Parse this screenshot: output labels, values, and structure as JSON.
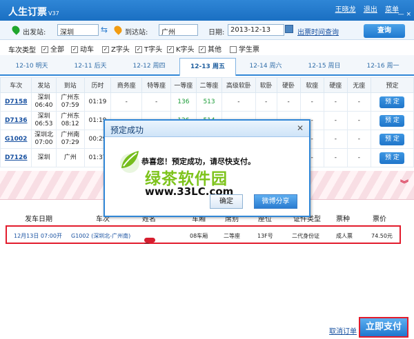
{
  "app": {
    "title": "人生订票",
    "version": "V37",
    "user": "王晓龙",
    "logout": "退出",
    "menu": "菜单",
    "min_btn": "—",
    "close_btn": "×"
  },
  "search": {
    "from_label": "出发站:",
    "from_value": "深圳",
    "to_label": "到达站:",
    "to_value": "广州",
    "date_label": "日期:",
    "date_value": "2013-12-13",
    "schedule_link": "出票时间查询",
    "query_button": "查询",
    "colors": {
      "from_pin": "#20a62d",
      "to_pin": "#f29c11"
    }
  },
  "filters": {
    "label": "车次类型",
    "items": [
      {
        "label": "全部",
        "checked": true
      },
      {
        "label": "动车",
        "checked": true
      },
      {
        "label": "Z字头",
        "checked": true
      },
      {
        "label": "T字头",
        "checked": true
      },
      {
        "label": "K字头",
        "checked": true
      },
      {
        "label": "其他",
        "checked": true
      },
      {
        "label": "学生票",
        "checked": false
      }
    ]
  },
  "date_tabs": [
    {
      "label": "12-10 明天"
    },
    {
      "label": "12-11 后天"
    },
    {
      "label": "12-12 周四"
    },
    {
      "label": "12-13 周五",
      "active": true
    },
    {
      "label": "12-14 周六"
    },
    {
      "label": "12-15 周日"
    },
    {
      "label": "12-16 周一"
    }
  ],
  "train_table": {
    "columns": [
      "车次",
      "发站",
      "到站",
      "历时",
      "商务座",
      "特等座",
      "一等座",
      "二等座",
      "高级软卧",
      "软卧",
      "硬卧",
      "软座",
      "硬座",
      "无座",
      "预定"
    ],
    "rows": [
      {
        "code": "D7158",
        "from": "深圳",
        "from_time": "06:40",
        "to": "广州东",
        "to_time": "07:59",
        "duration": "01:19",
        "business": "-",
        "special": "-",
        "first": "136",
        "second": "513",
        "h_soft": "-",
        "soft_sleeper": "-",
        "hard_sleeper": "-",
        "soft_seat": "-",
        "hard_seat": "-",
        "no_seat": "-",
        "book": "预 定"
      },
      {
        "code": "D7136",
        "from": "深圳",
        "from_time": "06:53",
        "to": "广州东",
        "to_time": "08:12",
        "duration": "01:19",
        "business": "-",
        "special": "-",
        "first": "126",
        "second": "514",
        "h_soft": "-",
        "soft_sleeper": "-",
        "hard_sleeper": "-",
        "soft_seat": "-",
        "hard_seat": "-",
        "no_seat": "-",
        "book": "预 定"
      },
      {
        "code": "G1002",
        "from": "深圳北",
        "from_time": "07:00",
        "to": "广州南",
        "to_time": "07:29",
        "duration": "00:29",
        "business": "-",
        "special": "-",
        "first": "-",
        "second": "-",
        "h_soft": "-",
        "soft_sleeper": "-",
        "hard_sleeper": "-",
        "soft_seat": "-",
        "hard_seat": "-",
        "no_seat": "-",
        "book": "预 定"
      },
      {
        "code": "D7126",
        "from": "深圳",
        "from_time": "",
        "to": "广州",
        "to_time": "",
        "duration": "01:37",
        "business": "-",
        "special": "-",
        "first": "-",
        "second": "-",
        "h_soft": "-",
        "soft_sleeper": "-",
        "hard_sleeper": "-",
        "soft_seat": "-",
        "hard_seat": "-",
        "no_seat": "-",
        "book": "预 定"
      }
    ]
  },
  "order_section": {
    "collapse_icon": "chevron-double-down-icon",
    "headers": [
      "发车日期",
      "车次",
      "姓名",
      "车厢",
      "席别",
      "座位",
      "证件类型",
      "票种",
      "票价"
    ],
    "row": {
      "date": "12月13日 07:00开",
      "train": "G1002 (深圳北-广州南)",
      "name": "王",
      "carriage": "08车厢",
      "seat_class": "二等座",
      "seat": "13F号",
      "id_type": "二代身份证",
      "ticket_type": "成人票",
      "price": "74.50元"
    },
    "cancel": "取消订单",
    "pay": "立即支付"
  },
  "dialog": {
    "title": "预定成功",
    "message": "恭喜您！预定成功，请尽快支付。",
    "watermark_cn": "绿茶软件园",
    "watermark_url": "www.33LC.com",
    "confirm": "确定",
    "share": "微博分享"
  }
}
